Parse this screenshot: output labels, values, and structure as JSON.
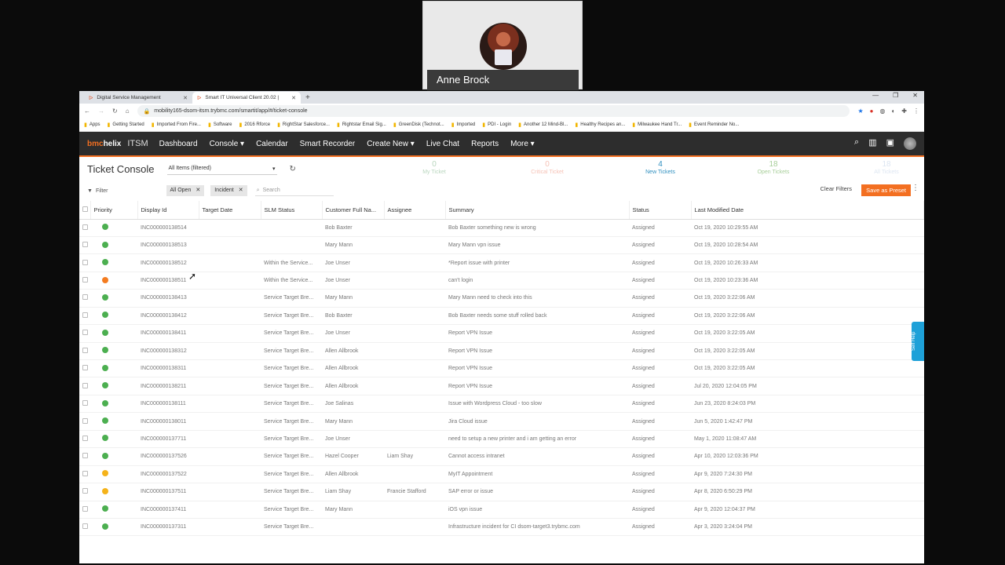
{
  "participant": {
    "name": "Anne Brock"
  },
  "browser": {
    "tabs": [
      {
        "label": "Digital Service Management",
        "active": false
      },
      {
        "label": "Smart IT Universal Client 20.02 |",
        "active": true
      }
    ],
    "new_tab": "+",
    "url": "mobility165-dsom-itsm.trybmc.com/smartit/app/#/ticket-console",
    "bookmarks": [
      "Apps",
      "Getting Started",
      "Imported From Fire...",
      "Software",
      "2016 Rforce",
      "RightStar Salesforce...",
      "Rightstar Email Sig...",
      "GreenDisk (Technot...",
      "Imported",
      "PDI - Login",
      "Another 12 Mind-Bl...",
      "Healthy Recipes an...",
      "Milwaukee Hand Tr...",
      "Event Reminder No..."
    ]
  },
  "appnav": {
    "logo_b": "bmc",
    "logo_rest": "helix",
    "product": "ITSM",
    "items": [
      "Dashboard",
      "Console ▾",
      "Calendar",
      "Smart Recorder",
      "Create New ▾",
      "Live Chat",
      "Reports",
      "More ▾"
    ]
  },
  "console": {
    "title": "Ticket Console",
    "filter_select": "All Items (filtered)",
    "counters": [
      {
        "n": "0",
        "label": "My Ticket",
        "color": "#b9d6be"
      },
      {
        "n": "0",
        "label": "Critical Ticket",
        "color": "#f6c2b6"
      },
      {
        "n": "4",
        "label": "New Tickets",
        "color": "#2f8fbf"
      },
      {
        "n": "18",
        "label": "Open Tickets",
        "color": "#a8cf9a"
      },
      {
        "n": "18",
        "label": "All Tickets",
        "color": "#dde6f2"
      }
    ],
    "filter_label": "Filter",
    "chips": [
      "All Open",
      "Incident"
    ],
    "search_placeholder": "Search",
    "clear_filters": "Clear Filters",
    "save_preset": "Save as Preset"
  },
  "table": {
    "columns": [
      "Priority",
      "Display Id",
      "Target Date",
      "SLM Status",
      "Customer Full Na...",
      "Assignee",
      "Summary",
      "Status",
      "Last Modified Date"
    ],
    "rows": [
      {
        "priority": "green",
        "id": "INC000000138514",
        "target": "",
        "slm": "",
        "customer": "Bob Baxter",
        "assignee": "",
        "summary": "Bob Baxter something new is wrong",
        "status": "Assigned",
        "modified": "Oct 19, 2020 10:29:55 AM"
      },
      {
        "priority": "green",
        "id": "INC000000138513",
        "target": "",
        "slm": "",
        "customer": "Mary Mann",
        "assignee": "",
        "summary": "Mary Mann vpn issue",
        "status": "Assigned",
        "modified": "Oct 19, 2020 10:28:54 AM"
      },
      {
        "priority": "green",
        "id": "INC000000138512",
        "target": "",
        "slm": "Within the Service...",
        "customer": "Joe Unser",
        "assignee": "",
        "summary": "*Report issue with printer",
        "status": "Assigned",
        "modified": "Oct 19, 2020 10:26:33 AM"
      },
      {
        "priority": "orange",
        "id": "INC000000138511",
        "target": "",
        "slm": "Within the Service...",
        "customer": "Joe Unser",
        "assignee": "",
        "summary": "can't login",
        "status": "Assigned",
        "modified": "Oct 19, 2020 10:23:36 AM"
      },
      {
        "priority": "green",
        "id": "INC000000138413",
        "target": "",
        "slm": "Service Target Bre...",
        "customer": "Mary Mann",
        "assignee": "",
        "summary": "Mary Mann need to check into this",
        "status": "Assigned",
        "modified": "Oct 19, 2020 3:22:06 AM"
      },
      {
        "priority": "green",
        "id": "INC000000138412",
        "target": "",
        "slm": "Service Target Bre...",
        "customer": "Bob Baxter",
        "assignee": "",
        "summary": "Bob Baxter needs some stuff rolled back",
        "status": "Assigned",
        "modified": "Oct 19, 2020 3:22:06 AM"
      },
      {
        "priority": "green",
        "id": "INC000000138411",
        "target": "",
        "slm": "Service Target Bre...",
        "customer": "Joe Unser",
        "assignee": "",
        "summary": "Report VPN Issue",
        "status": "Assigned",
        "modified": "Oct 19, 2020 3:22:05 AM"
      },
      {
        "priority": "green",
        "id": "INC000000138312",
        "target": "",
        "slm": "Service Target Bre...",
        "customer": "Allen Allbrook",
        "assignee": "",
        "summary": "Report VPN Issue",
        "status": "Assigned",
        "modified": "Oct 19, 2020 3:22:05 AM"
      },
      {
        "priority": "green",
        "id": "INC000000138311",
        "target": "",
        "slm": "Service Target Bre...",
        "customer": "Allen Allbrook",
        "assignee": "",
        "summary": "Report VPN Issue",
        "status": "Assigned",
        "modified": "Oct 19, 2020 3:22:05 AM"
      },
      {
        "priority": "green",
        "id": "INC000000138211",
        "target": "",
        "slm": "Service Target Bre...",
        "customer": "Allen Allbrook",
        "assignee": "",
        "summary": "Report VPN Issue",
        "status": "Assigned",
        "modified": "Jul 20, 2020 12:04:05 PM"
      },
      {
        "priority": "green",
        "id": "INC000000138111",
        "target": "",
        "slm": "Service Target Bre...",
        "customer": "Joe Salinas",
        "assignee": "",
        "summary": "Issue with Wordpress Cloud - too slow",
        "status": "Assigned",
        "modified": "Jun 23, 2020 8:24:03 PM"
      },
      {
        "priority": "green",
        "id": "INC000000138011",
        "target": "",
        "slm": "Service Target Bre...",
        "customer": "Mary Mann",
        "assignee": "",
        "summary": "Jira Cloud issue",
        "status": "Assigned",
        "modified": "Jun 5, 2020 1:42:47 PM"
      },
      {
        "priority": "green",
        "id": "INC000000137711",
        "target": "",
        "slm": "Service Target Bre...",
        "customer": "Joe Unser",
        "assignee": "",
        "summary": "need to setup a new printer and i am getting an error",
        "status": "Assigned",
        "modified": "May 1, 2020 11:08:47 AM"
      },
      {
        "priority": "green",
        "id": "INC000000137526",
        "target": "",
        "slm": "Service Target Bre...",
        "customer": "Hazel Cooper",
        "assignee": "Liam Shay",
        "summary": "Cannot access intranet",
        "status": "Assigned",
        "modified": "Apr 10, 2020 12:03:36 PM"
      },
      {
        "priority": "yellow",
        "id": "INC000000137522",
        "target": "",
        "slm": "Service Target Bre...",
        "customer": "Allen Allbrook",
        "assignee": "",
        "summary": "MyIT Appointment",
        "status": "Assigned",
        "modified": "Apr 9, 2020 7:24:30 PM"
      },
      {
        "priority": "yellow",
        "id": "INC000000137511",
        "target": "",
        "slm": "Service Target Bre...",
        "customer": "Liam Shay",
        "assignee": "Francie Stafford",
        "summary": "SAP error or issue",
        "status": "Assigned",
        "modified": "Apr 8, 2020 6:50:29 PM"
      },
      {
        "priority": "green",
        "id": "INC000000137411",
        "target": "",
        "slm": "Service Target Bre...",
        "customer": "Mary Mann",
        "assignee": "",
        "summary": "iOS vpn issue",
        "status": "Assigned",
        "modified": "Apr 9, 2020 12:04:37 PM"
      },
      {
        "priority": "green",
        "id": "INC000000137311",
        "target": "",
        "slm": "Service Target Bre...",
        "customer": "",
        "assignee": "",
        "summary": "Infrastructure incident for CI dsom-target3.trybmc.com",
        "status": "Assigned",
        "modified": "Apr 3, 2020 3:24:04 PM"
      }
    ]
  },
  "colors": {
    "green": "#4caf50",
    "orange": "#f47c20",
    "yellow": "#f5b31a",
    "accent": "#f36f21"
  },
  "self_help": "Self Help"
}
